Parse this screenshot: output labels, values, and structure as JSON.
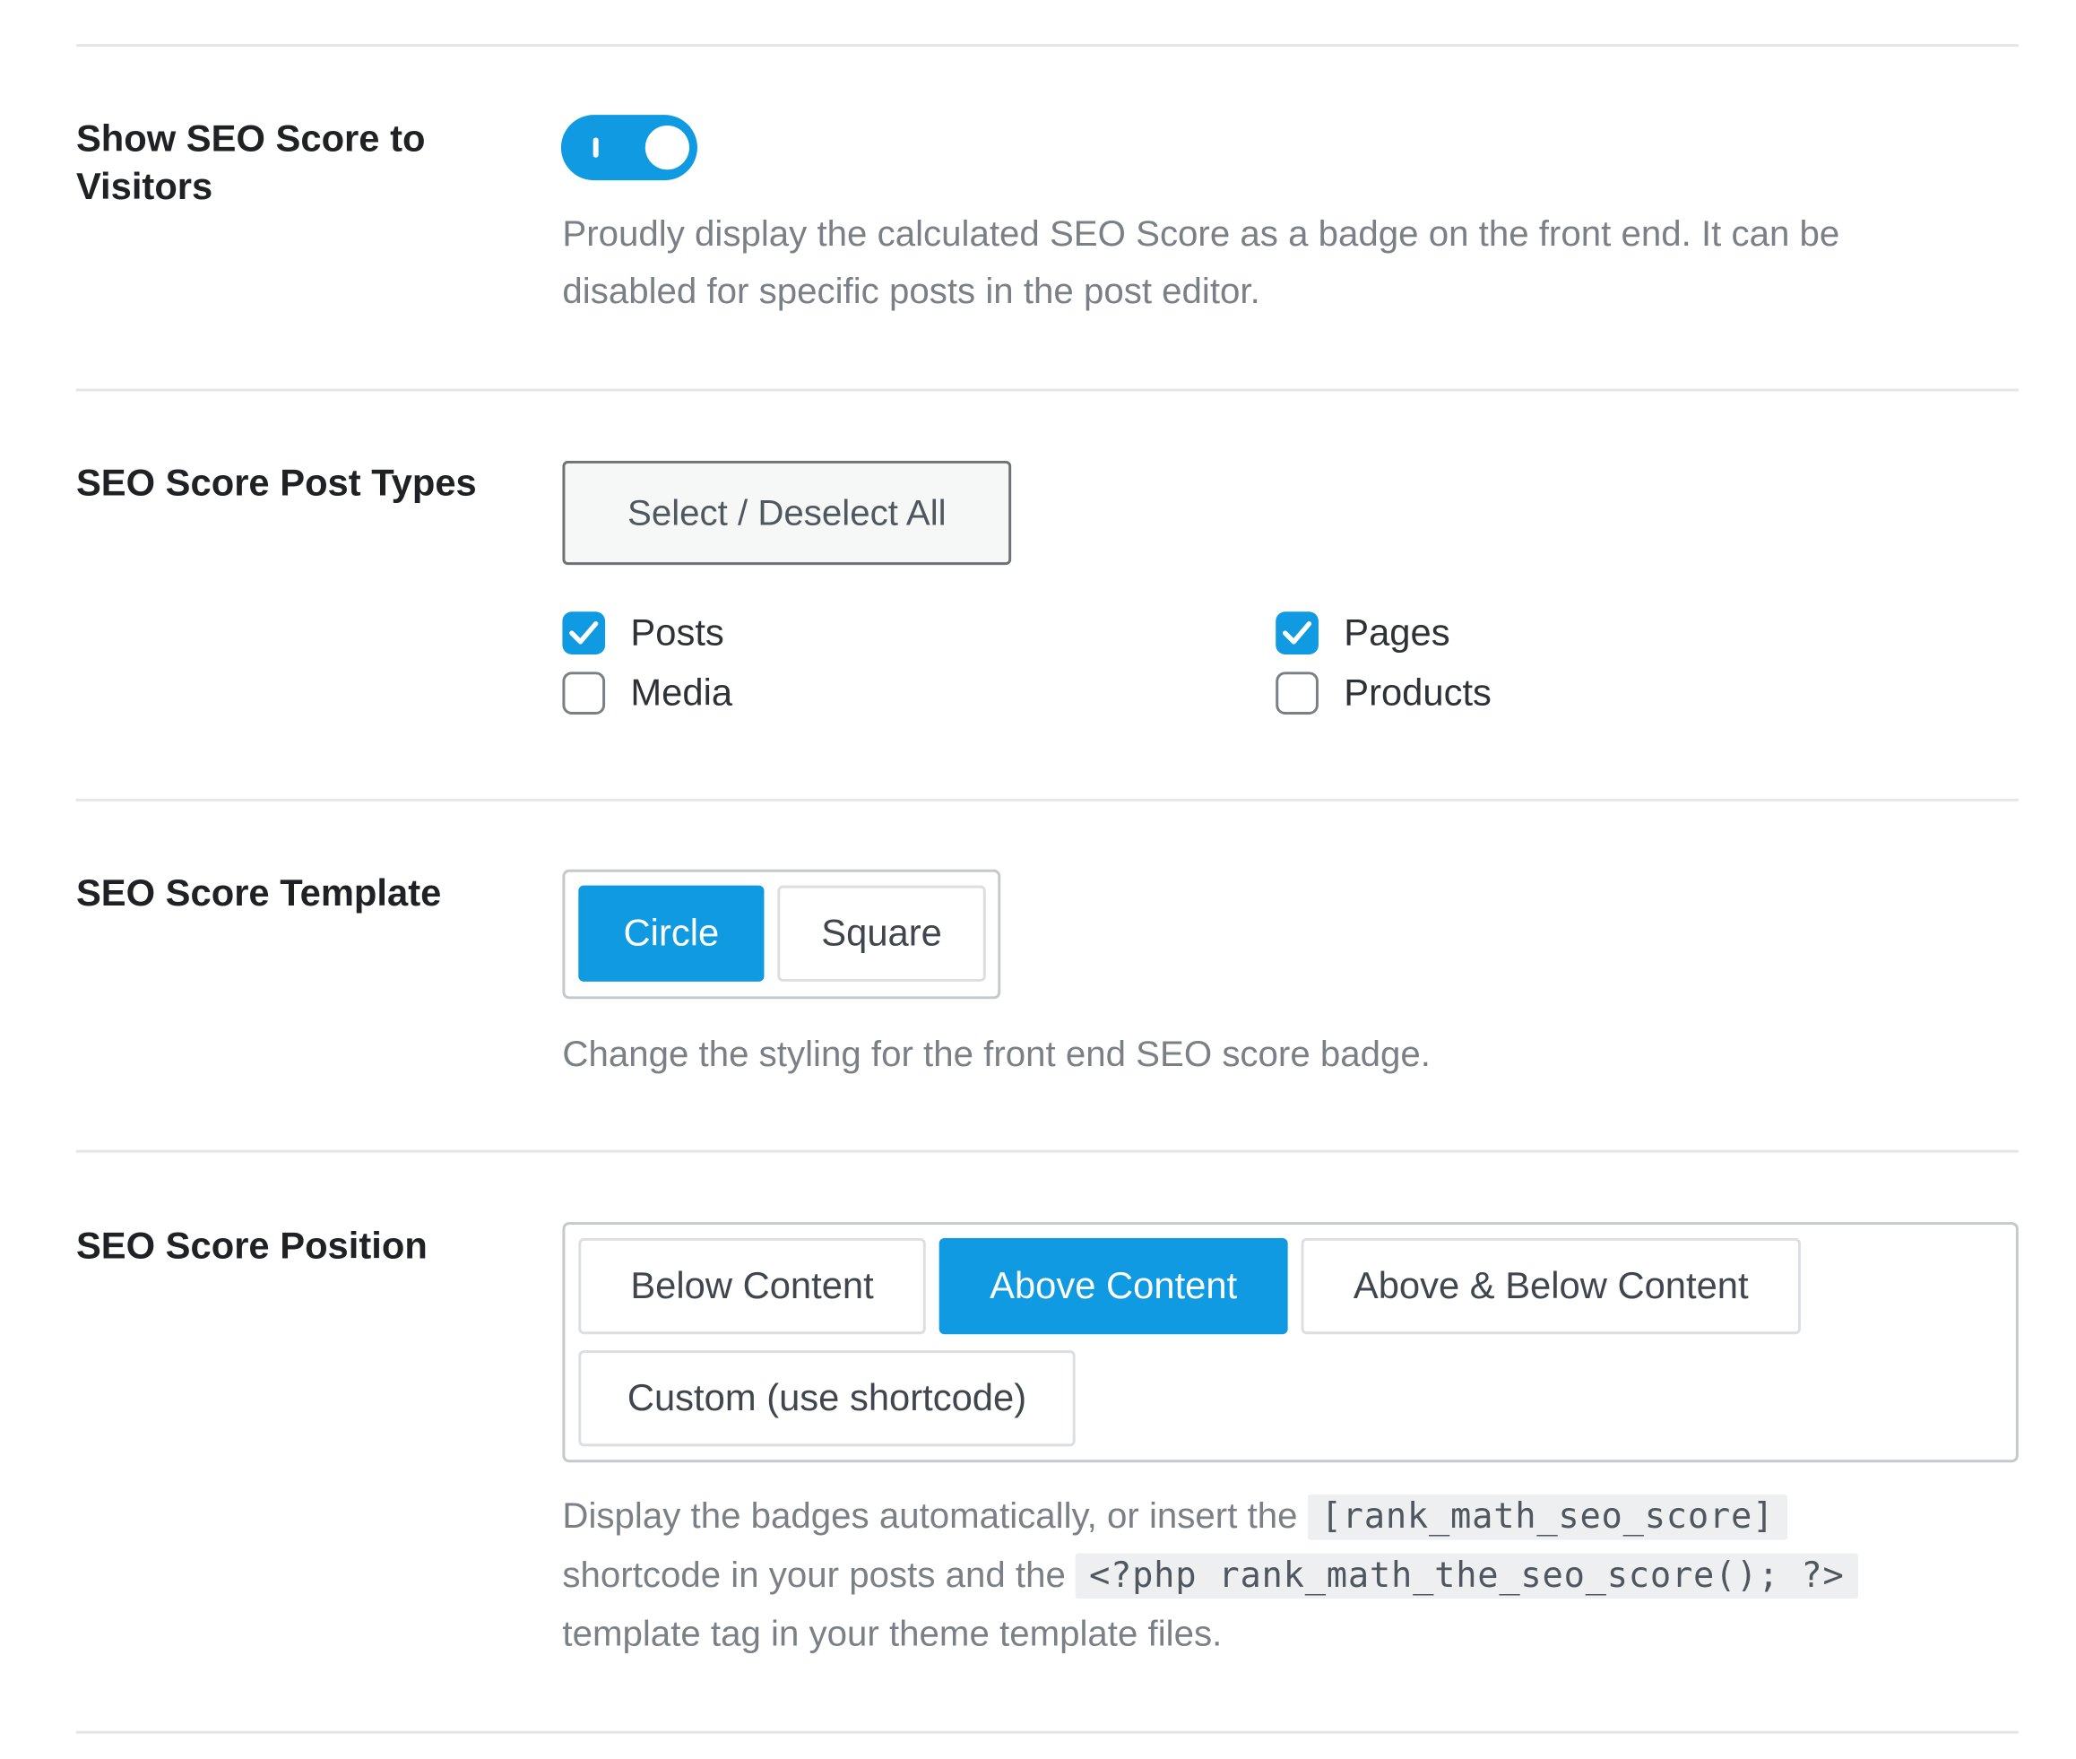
{
  "settings": {
    "show_score": {
      "label": "Show SEO Score to Visitors",
      "toggle_on": true,
      "description": "Proudly display the calculated SEO Score as a badge on the front end. It can be disabled for specific posts in the post editor."
    },
    "post_types": {
      "label": "SEO Score Post Types",
      "select_all_label": "Select / Deselect All",
      "options": [
        {
          "label": "Posts",
          "checked": true
        },
        {
          "label": "Pages",
          "checked": true
        },
        {
          "label": "Media",
          "checked": false
        },
        {
          "label": "Products",
          "checked": false
        }
      ]
    },
    "template": {
      "label": "SEO Score Template",
      "options": [
        "Circle",
        "Square"
      ],
      "selected": "Circle",
      "description": "Change the styling for the front end SEO score badge."
    },
    "position": {
      "label": "SEO Score Position",
      "options": [
        "Below Content",
        "Above Content",
        "Above & Below Content",
        "Custom (use shortcode)"
      ],
      "selected": "Above Content",
      "description": {
        "part1": "Display the badges automatically, or insert the ",
        "code1": "[rank_math_seo_score]",
        "part2": "shortcode in your posts and the ",
        "code2": "<?php rank_math_the_seo_score(); ?>",
        "part3": "template tag in your theme template files."
      }
    }
  },
  "colors": {
    "accent": "#0f9ae2",
    "label": "#1f2125",
    "description": "#7b8087",
    "divider": "#e4e5e7"
  },
  "icons": {
    "check": "checkmark-icon"
  }
}
